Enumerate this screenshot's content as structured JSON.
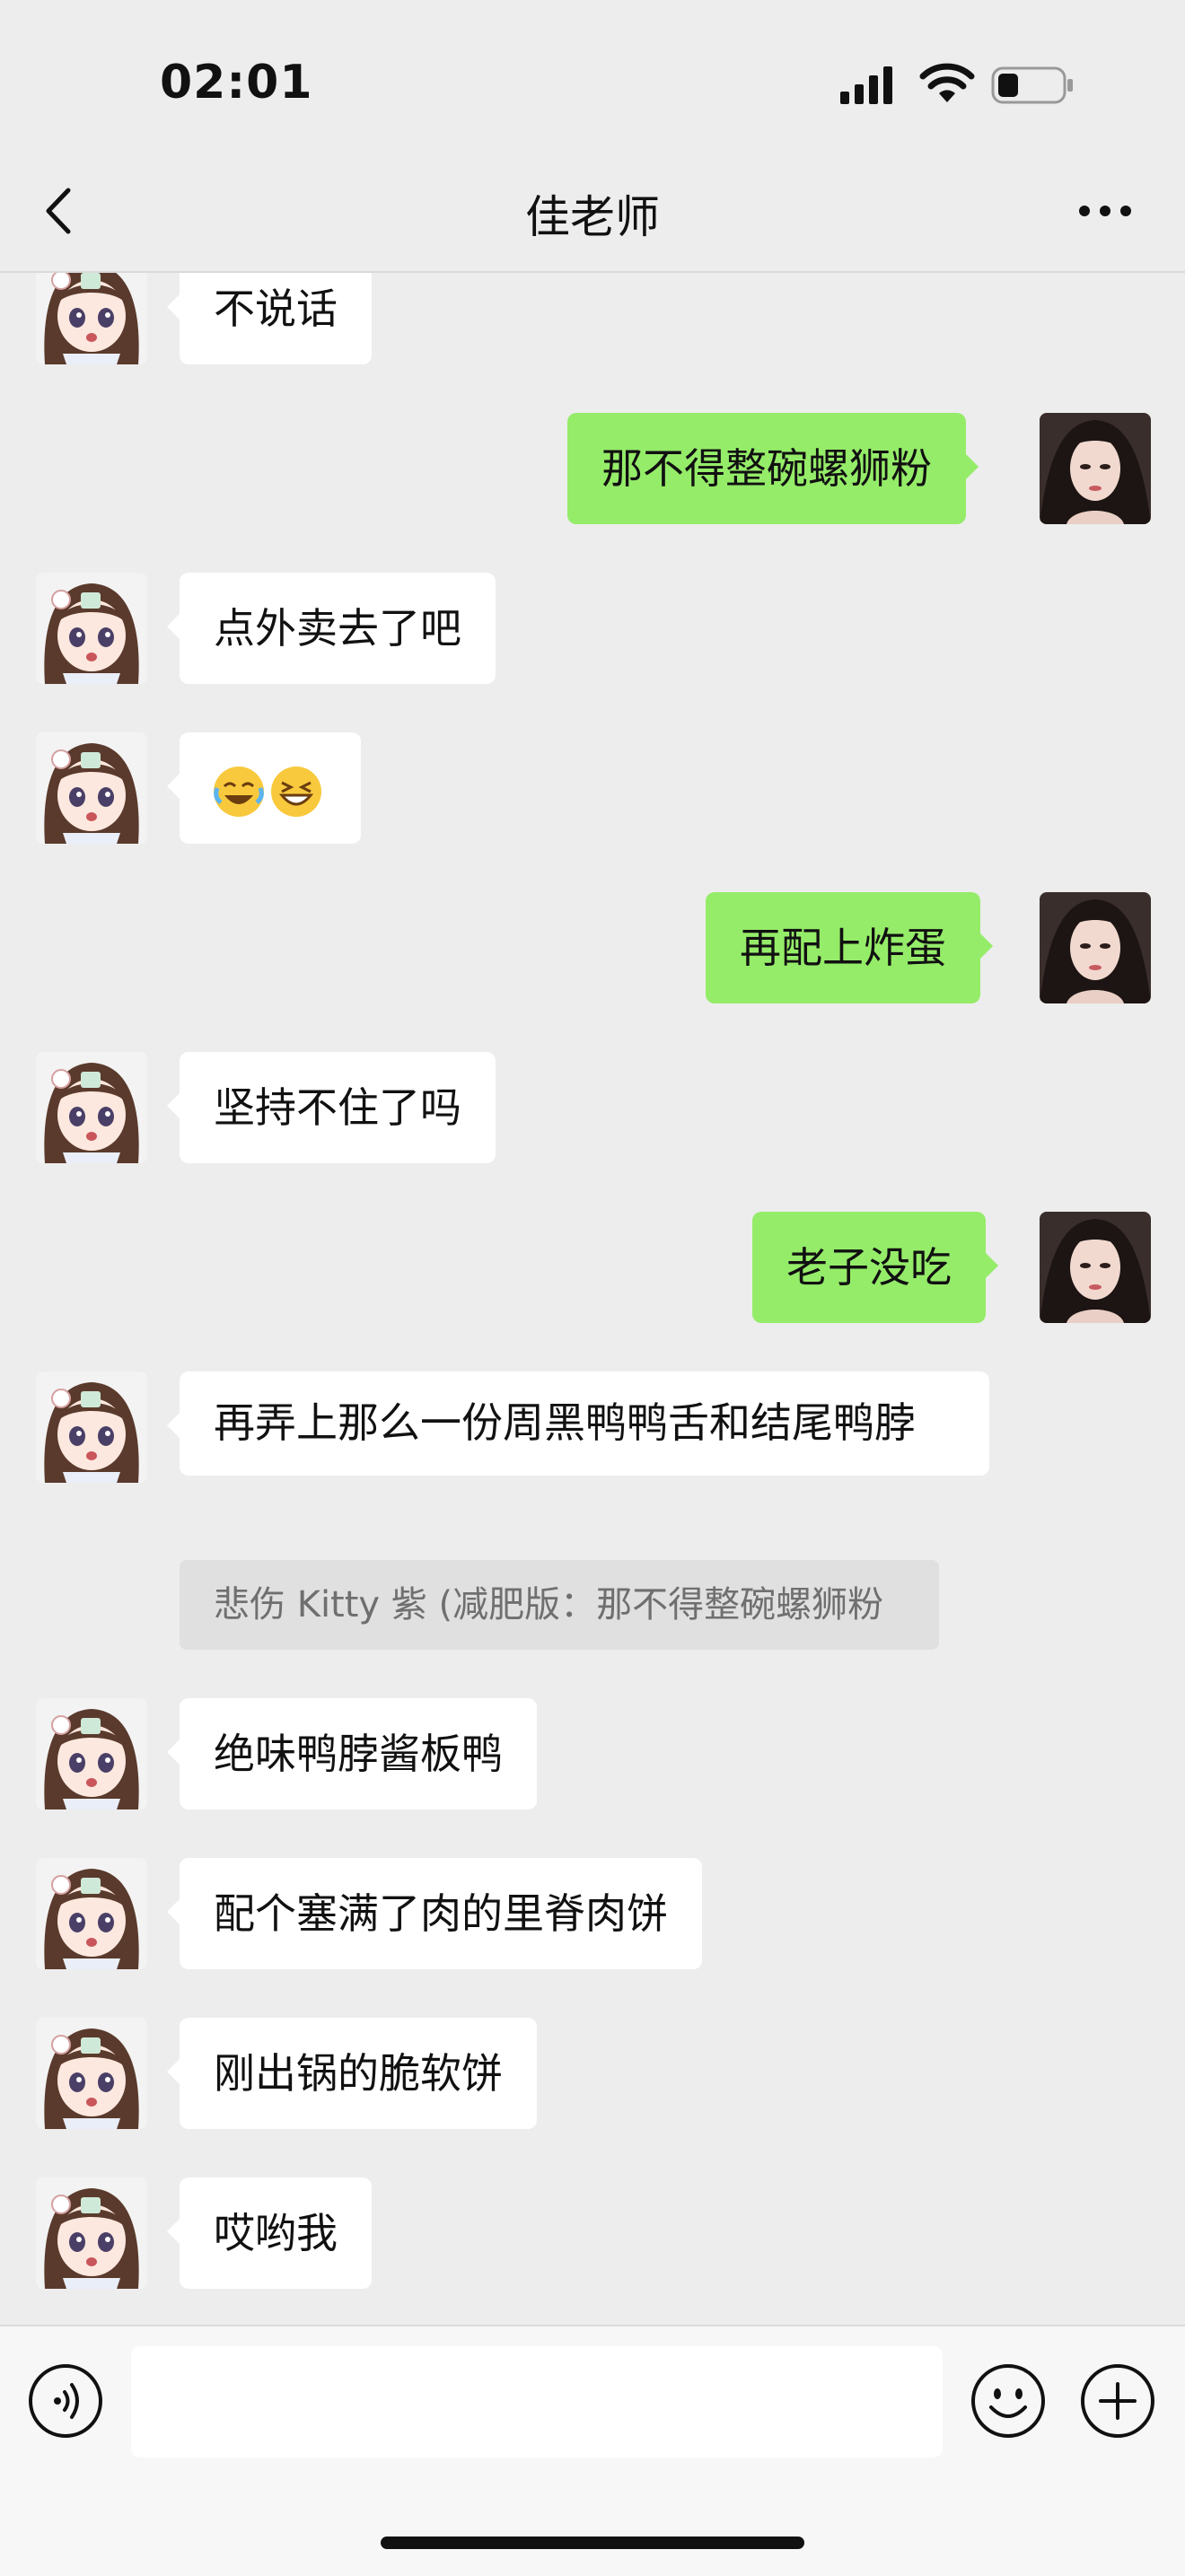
{
  "status": {
    "time": "02:01"
  },
  "nav": {
    "title": "佳老师"
  },
  "messages": {
    "m0": "不说话",
    "m1": "那不得整碗螺狮粉",
    "m2": "点外卖去了吧",
    "m3_emojis": [
      "face-with-tears-of-joy-icon",
      "grinning-squinting-face-icon"
    ],
    "m4": "再配上炸蛋",
    "m5": "坚持不住了吗",
    "m6": "老子没吃",
    "m7": "再弄上那么一份周黑鸭鸭舌和结尾鸭脖",
    "m7_quote": "悲伤 Kitty 紫 (减肥版：那不得整碗螺狮粉",
    "m8": "绝味鸭脖酱板鸭",
    "m9": "配个塞满了肉的里脊肉饼",
    "m10": "刚出锅的脆软饼",
    "m11": "哎哟我"
  },
  "input": {
    "value": "",
    "placeholder": ""
  },
  "colors": {
    "background": "#ededed",
    "sent_bubble": "#95ec69",
    "received_bubble": "#ffffff"
  }
}
